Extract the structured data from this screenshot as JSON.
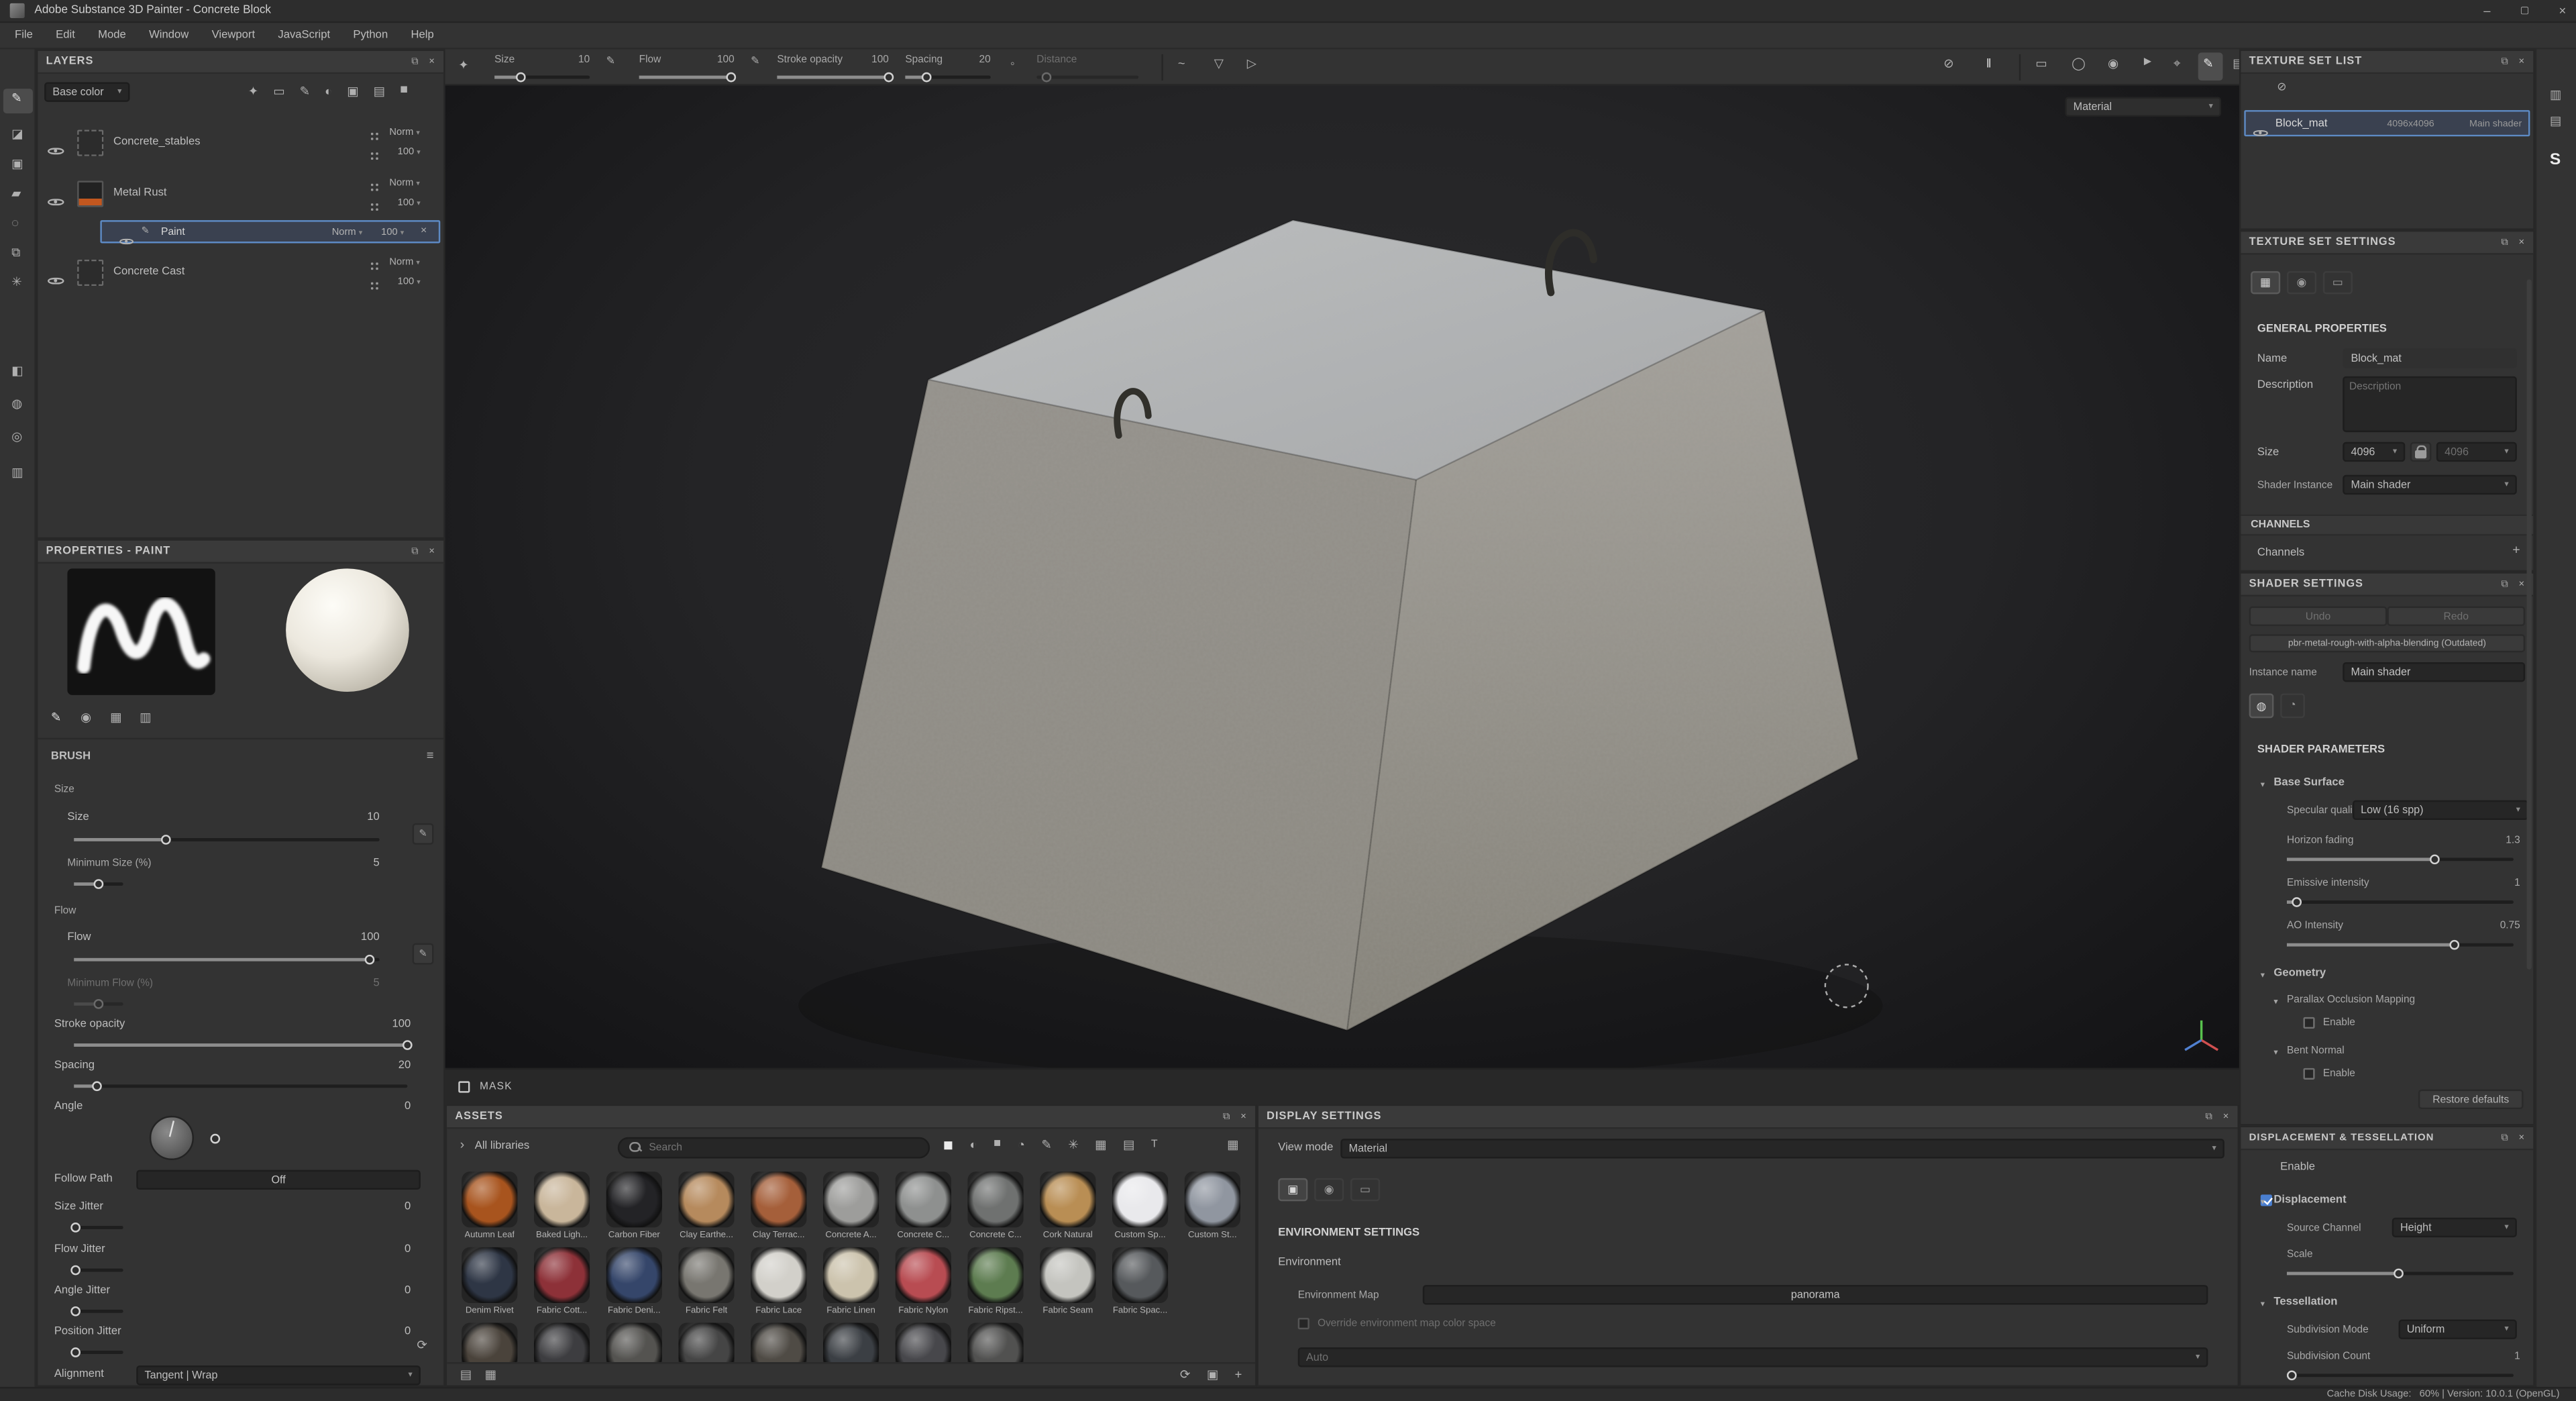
{
  "titlebar": {
    "title": "Adobe Substance 3D Painter - Concrete Block"
  },
  "menubar": {
    "items": [
      "File",
      "Edit",
      "Mode",
      "Window",
      "Viewport",
      "JavaScript",
      "Python",
      "Help"
    ]
  },
  "toolbar": {
    "size": {
      "label": "Size",
      "value": "10"
    },
    "flow": {
      "label": "Flow",
      "value": "100"
    },
    "stroke_opacity": {
      "label": "Stroke opacity",
      "value": "100"
    },
    "spacing": {
      "label": "Spacing",
      "value": "20"
    },
    "distance": {
      "label": "Distance"
    }
  },
  "layers_panel": {
    "title": "LAYERS",
    "blend_mode": "Base color",
    "layers": [
      {
        "name": "Concrete_stables",
        "blend": "Norm",
        "opacity": "100"
      },
      {
        "name": "Metal Rust",
        "blend": "Norm",
        "opacity": "100"
      },
      {
        "name": "Paint",
        "blend": "Norm",
        "opacity": "100"
      },
      {
        "name": "Concrete Cast",
        "blend": "Norm",
        "opacity": "100"
      }
    ]
  },
  "properties_panel": {
    "title": "PROPERTIES - PAINT",
    "section_brush": "BRUSH",
    "size_group": "Size",
    "size": {
      "label": "Size",
      "value": "10"
    },
    "min_size": {
      "label": "Minimum Size (%)",
      "value": "5"
    },
    "flow_group": "Flow",
    "flow": {
      "label": "Flow",
      "value": "100"
    },
    "min_flow": {
      "label": "Minimum Flow (%)",
      "value": "5"
    },
    "stroke_opacity": {
      "label": "Stroke opacity",
      "value": "100"
    },
    "spacing": {
      "label": "Spacing",
      "value": "20"
    },
    "angle": {
      "label": "Angle",
      "value": "0"
    },
    "follow_path": {
      "label": "Follow Path",
      "value": "Off"
    },
    "size_jitter": {
      "label": "Size Jitter",
      "value": "0"
    },
    "flow_jitter": {
      "label": "Flow Jitter",
      "value": "0"
    },
    "angle_jitter": {
      "label": "Angle Jitter",
      "value": "0"
    },
    "position_jitter": {
      "label": "Position Jitter",
      "value": "0"
    },
    "alignment": {
      "label": "Alignment",
      "value": "Tangent | Wrap"
    }
  },
  "viewport": {
    "material_dropdown": "Material",
    "mask_label": "MASK"
  },
  "assets_panel": {
    "title": "ASSETS",
    "library_selector": "All libraries",
    "search_placeholder": "Search",
    "assets_row1": [
      {
        "name": "Autumn Leaf",
        "color": "#a8541e"
      },
      {
        "name": "Baked Ligh...",
        "color": "#c9b69b"
      },
      {
        "name": "Carbon Fiber",
        "color": "#232326"
      },
      {
        "name": "Clay Earthe...",
        "color": "#b68a5d"
      },
      {
        "name": "Clay Terrac...",
        "color": "#a55f3a"
      },
      {
        "name": "Concrete A...",
        "color": "#9d9d9b"
      },
      {
        "name": "Concrete C...",
        "color": "#8e908f"
      },
      {
        "name": "Concrete C...",
        "color": "#6f7170"
      },
      {
        "name": "Cork Natural",
        "color": "#b98e54"
      },
      {
        "name": "Custom Sp...",
        "color": "#e9e9ec"
      },
      {
        "name": "Custom St...",
        "color": "#9096a0"
      }
    ],
    "assets_row2": [
      {
        "name": "Denim Rivet",
        "color": "#2e3645"
      },
      {
        "name": "Fabric Cott...",
        "color": "#8d3138"
      },
      {
        "name": "Fabric Deni...",
        "color": "#35466a"
      },
      {
        "name": "Fabric Felt",
        "color": "#787670"
      },
      {
        "name": "Fabric Lace",
        "color": "#d2d0ca"
      },
      {
        "name": "Fabric Linen",
        "color": "#ccc3ad"
      },
      {
        "name": "Fabric Nylon",
        "color": "#b84c52"
      },
      {
        "name": "Fabric Ripst...",
        "color": "#5d7c50"
      },
      {
        "name": "Fabric Seam",
        "color": "#c4c4bf"
      },
      {
        "name": "Fabric Spac...",
        "color": "#56595c"
      }
    ],
    "assets_row3_colors": [
      "#4a433b",
      "#3d3d40",
      "#545350",
      "#454545",
      "#4f4b45",
      "#3b3f44",
      "#47474b",
      "#515150"
    ]
  },
  "display_settings": {
    "title": "DISPLAY SETTINGS",
    "view_mode_label": "View mode",
    "view_mode_value": "Material",
    "environment_section": "ENVIRONMENT SETTINGS",
    "environment_label": "Environment",
    "environment_map_label": "Environment Map",
    "environment_map_value": "panorama",
    "override_checkbox_label": "Override environment map color space",
    "tonemapping_value": "Auto"
  },
  "texture_set_list": {
    "title": "TEXTURE SET LIST",
    "row": {
      "name": "Block_mat",
      "resolution": "4096x4096",
      "shader": "Main shader"
    }
  },
  "texture_set_settings": {
    "title": "TEXTURE SET SETTINGS",
    "general_section": "GENERAL PROPERTIES",
    "name_label": "Name",
    "name_value": "Block_mat",
    "description_label": "Description",
    "description_placeholder": "Description",
    "size_label": "Size",
    "size_value": "4096",
    "size_value_locked": "4096",
    "shader_instance_label": "Shader Instance",
    "shader_instance_value": "Main shader",
    "channels_section": "CHANNELS",
    "channels_label": "Channels"
  },
  "shader_settings": {
    "title": "SHADER SETTINGS",
    "undo": "Undo",
    "redo": "Redo",
    "shader_button": "pbr-metal-rough-with-alpha-blending (Outdated)",
    "instance_name_label": "Instance name",
    "instance_name_value": "Main shader",
    "parameters_section": "SHADER PARAMETERS",
    "base_surface": "Base Surface",
    "specular_quality_label": "Specular quality",
    "specular_quality_value": "Low (16 spp)",
    "horizon_fading": {
      "label": "Horizon fading",
      "value": "1.3"
    },
    "emissive_intensity": {
      "label": "Emissive intensity",
      "value": "1"
    },
    "ao_intensity": {
      "label": "AO Intensity",
      "value": "0.75"
    },
    "geometry": "Geometry",
    "pom": "Parallax Occlusion Mapping",
    "pom_enable": "Enable",
    "bent_normal": "Bent Normal",
    "bent_enable": "Enable",
    "restore_defaults": "Restore defaults"
  },
  "displacement_panel": {
    "title": "DISPLACEMENT & TESSELLATION",
    "enable": "Enable",
    "displacement": "Displacement",
    "source_channel_label": "Source Channel",
    "source_channel_value": "Height",
    "scale_label": "Scale",
    "tessellation": "Tessellation",
    "subdivision_mode_label": "Subdivision Mode",
    "subdivision_mode_value": "Uniform",
    "subdivision_count": {
      "label": "Subdivision Count",
      "value": "1"
    }
  },
  "statusbar": {
    "text": "Cache Disk Usage:   60% | Version: 10.0.1 (OpenGL)"
  },
  "ic": {
    "close": "×",
    "float": "⧉",
    "caret": "▾",
    "chev_r": "›",
    "plus": "+",
    "min": "–",
    "max": "▢",
    "pause": "‖",
    "no": "⊘",
    "marquee": "▭",
    "circ": "◯",
    "cam": "◉",
    "vid": "▶",
    "pivot": "⌖",
    "pen": "✎",
    "img": "▤",
    "spark": "✦",
    "dot": "◦",
    "wave": "~",
    "tdown": "▽",
    "tright": "▷",
    "eraser": "◪",
    "proj": "▣",
    "fillt": "▰",
    "smudge": "◌",
    "clone": "⧉",
    "part": "✳",
    "maskt": "◧",
    "smat": "◍",
    "smask": "◎",
    "grid": "▦",
    "rows": "▥",
    "list": "▤",
    "refresh": "⟳",
    "half": "◐",
    "quart": "◔",
    "sqf": "◼",
    "tee": "T",
    "menu": "≡"
  }
}
